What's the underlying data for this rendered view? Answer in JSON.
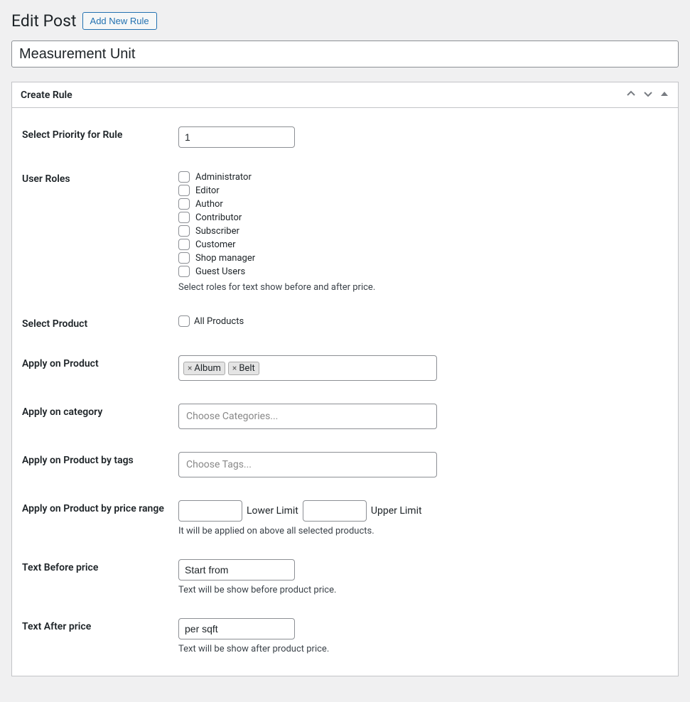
{
  "header": {
    "title": "Edit Post",
    "add_button": "Add New Rule"
  },
  "post_title": "Measurement Unit",
  "metabox": {
    "title": "Create Rule"
  },
  "fields": {
    "priority": {
      "label": "Select Priority for Rule",
      "value": "1"
    },
    "user_roles": {
      "label": "User Roles",
      "options": [
        "Administrator",
        "Editor",
        "Author",
        "Contributor",
        "Subscriber",
        "Customer",
        "Shop manager",
        "Guest Users"
      ],
      "description": "Select roles for text show before and after price."
    },
    "select_product": {
      "label": "Select Product",
      "checkbox_label": "All Products"
    },
    "apply_product": {
      "label": "Apply on Product",
      "tags": [
        "Album",
        "Belt"
      ]
    },
    "apply_category": {
      "label": "Apply on category",
      "placeholder": "Choose Categories..."
    },
    "apply_tags": {
      "label": "Apply on Product by tags",
      "placeholder": "Choose Tags..."
    },
    "apply_price_range": {
      "label": "Apply on Product by price range",
      "lower_label": "Lower Limit",
      "upper_label": "Upper Limit",
      "description": "It will be applied on above all selected products."
    },
    "text_before": {
      "label": "Text Before price",
      "value": "Start from",
      "description": "Text will be show before product price."
    },
    "text_after": {
      "label": "Text After price",
      "value": "per sqft",
      "description": "Text will be show after product price."
    }
  }
}
